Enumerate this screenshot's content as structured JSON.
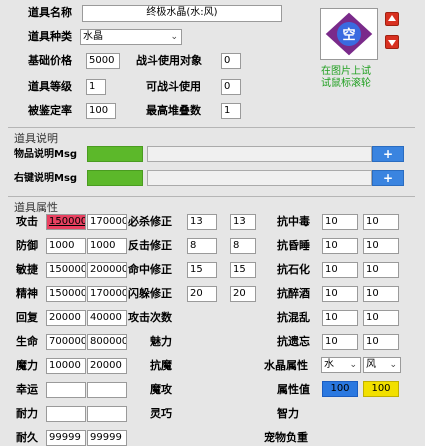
{
  "fields": {
    "name_label": "道具名称",
    "name_value": "终极水晶(水:风)",
    "type_label": "道具种类",
    "type_value": "水晶",
    "base_price_label": "基础价格",
    "base_price_value": "5000",
    "battle_target_label": "战斗使用对象",
    "battle_target_value": "0",
    "level_label": "道具等级",
    "level_value": "1",
    "battle_usable_label": "可战斗使用",
    "battle_usable_value": "0",
    "identify_label": "被鉴定率",
    "identify_value": "100",
    "max_stack_label": "最高堆叠数",
    "max_stack_value": "1"
  },
  "image_panel": {
    "icon_glyph": "空",
    "hint_line1": "在图片上试",
    "hint_line2": "试鼠标滚轮"
  },
  "desc_section": {
    "title": "道具说明",
    "item_desc_label": "物品说明Msg",
    "right_desc_label": "右键说明Msg",
    "add_label": "+"
  },
  "attr_section": {
    "title": "道具属性",
    "rows": [
      {
        "l1": "攻击",
        "v1": "150000",
        "v2": "170000",
        "l2": "必杀修正",
        "v3": "13",
        "v4": "13",
        "l3": "抗中毒",
        "v5": "10",
        "v6": "10"
      },
      {
        "l1": "防御",
        "v1": "1000",
        "v2": "1000",
        "l2": "反击修正",
        "v3": "8",
        "v4": "8",
        "l3": "抗昏睡",
        "v5": "10",
        "v6": "10"
      },
      {
        "l1": "敏捷",
        "v1": "150000",
        "v2": "200000",
        "l2": "命中修正",
        "v3": "15",
        "v4": "15",
        "l3": "抗石化",
        "v5": "10",
        "v6": "10"
      },
      {
        "l1": "精神",
        "v1": "150000",
        "v2": "170000",
        "l2": "闪躲修正",
        "v3": "20",
        "v4": "20",
        "l3": "抗醉酒",
        "v5": "10",
        "v6": "10"
      },
      {
        "l1": "回复",
        "v1": "20000",
        "v2": "40000",
        "l2": "攻击次数",
        "v3": "",
        "v4": "",
        "l3": "抗混乱",
        "v5": "10",
        "v6": "10"
      },
      {
        "l1": "生命",
        "v1": "700000",
        "v2": "800000",
        "l2": "魅力",
        "v3": "",
        "v4": "",
        "l3": "抗遗忘",
        "v5": "10",
        "v6": "10"
      },
      {
        "l1": "魔力",
        "v1": "10000",
        "v2": "20000",
        "l2": "抗魔",
        "v3": "",
        "v4": "",
        "l3": "水晶属性",
        "v5": "",
        "v6": ""
      },
      {
        "l1": "幸运",
        "v1": "",
        "v2": "",
        "l2": "魔攻",
        "v3": "",
        "v4": "",
        "l3": "属性值",
        "v5": "",
        "v6": ""
      },
      {
        "l1": "耐力",
        "v1": "",
        "v2": "",
        "l2": "灵巧",
        "v3": "",
        "v4": "",
        "l3": "智力",
        "v5": "",
        "v6": ""
      },
      {
        "l1": "耐久",
        "v1": "99999",
        "v2": "99999",
        "l2": "",
        "v3": "",
        "v4": "",
        "l3": "宠物负重",
        "v5": "",
        "v6": ""
      }
    ],
    "crystal_attr_1": "水",
    "crystal_attr_2": "风",
    "attr_value_1": "100",
    "attr_value_2": "100"
  },
  "colors": {
    "highlight_red": "#e84060",
    "attr_blue": "#2a78e0",
    "attr_yellow": "#f2e000",
    "desc_green": "#5cb82a"
  }
}
